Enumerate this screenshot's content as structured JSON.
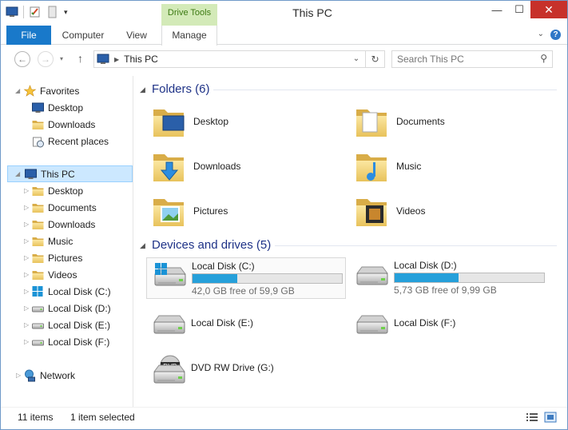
{
  "window": {
    "title": "This PC"
  },
  "ribbon": {
    "context_group": "Drive Tools",
    "tabs": [
      {
        "label": "File"
      },
      {
        "label": "Computer"
      },
      {
        "label": "View"
      },
      {
        "label": "Manage"
      }
    ],
    "help": "?"
  },
  "address": {
    "path": "This PC",
    "search_placeholder": "Search This PC"
  },
  "nav": {
    "favorites": {
      "label": "Favorites",
      "items": [
        "Desktop",
        "Downloads",
        "Recent places"
      ]
    },
    "this_pc": {
      "label": "This PC",
      "items": [
        "Desktop",
        "Documents",
        "Downloads",
        "Music",
        "Pictures",
        "Videos",
        "Local Disk (C:)",
        "Local Disk (D:)",
        "Local Disk (E:)",
        "Local Disk (F:)"
      ]
    },
    "network": {
      "label": "Network"
    }
  },
  "folders": {
    "header": "Folders (6)",
    "items": [
      "Desktop",
      "Documents",
      "Downloads",
      "Music",
      "Pictures",
      "Videos"
    ]
  },
  "devices": {
    "header": "Devices and drives (5)",
    "items": [
      {
        "label": "Local Disk (C:)",
        "free": "42,0 GB free of 59,9 GB",
        "used_fraction": 0.3
      },
      {
        "label": "Local Disk (D:)",
        "free": "5,73 GB free of 9,99 GB",
        "used_fraction": 0.43
      },
      {
        "label": "Local Disk (E:)"
      },
      {
        "label": "Local Disk (F:)"
      },
      {
        "label": "DVD RW Drive (G:)",
        "badge": "DVD"
      }
    ]
  },
  "status": {
    "count": "11 items",
    "selected": "1 item selected"
  },
  "colors": {
    "accent": "#1979ca",
    "selection": "#cce8ff",
    "drive_bar": "#26a0da",
    "group_header": "#1e3287",
    "close": "#c7312a"
  }
}
